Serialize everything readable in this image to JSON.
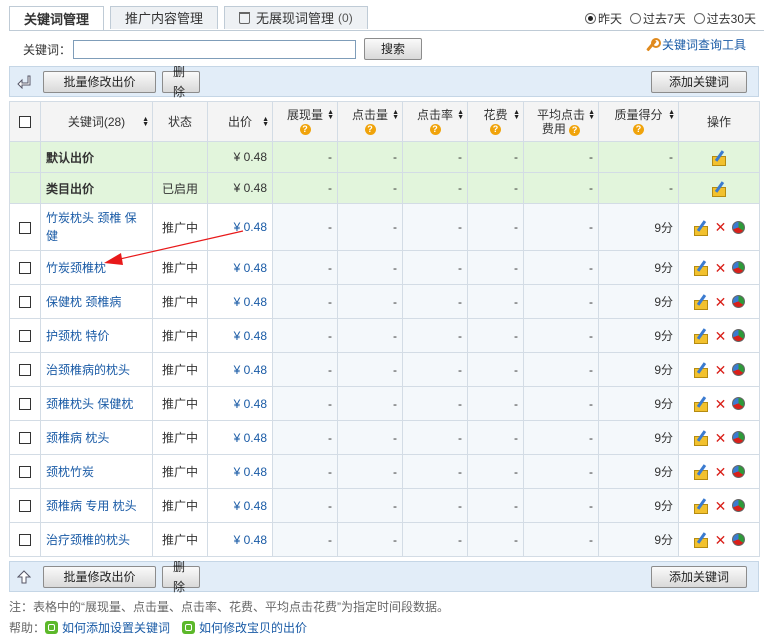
{
  "tabs": [
    {
      "label": "关键词管理",
      "active": true
    },
    {
      "label": "推广内容管理",
      "active": false
    },
    {
      "label": "无展现词管理",
      "count": "(0)",
      "active": false
    }
  ],
  "time_ranges": [
    {
      "label": "昨天",
      "selected": true
    },
    {
      "label": "过去7天",
      "selected": false
    },
    {
      "label": "过去30天",
      "selected": false
    }
  ],
  "search": {
    "label": "关键词：",
    "value": "",
    "placeholder": "",
    "button": "搜索",
    "tool_link": "关键词查询工具",
    "tool_icon": "wrench-icon"
  },
  "actions": {
    "bulk_price": "批量修改出价",
    "delete": "删除",
    "add_keyword": "添加关键词"
  },
  "table": {
    "headers": {
      "keyword": "关键词(28)",
      "status": "状态",
      "bid": "出价",
      "impressions": "展现量",
      "clicks": "点击量",
      "ctr": "点击率",
      "cost": "花费",
      "avg_cpc_line1": "平均点击",
      "avg_cpc_line2": "费用",
      "quality": "质量得分",
      "ops": "操作"
    },
    "default_rows": [
      {
        "name": "默认出价",
        "status": "",
        "bid": "¥ 0.48",
        "impressions": "-",
        "clicks": "-",
        "ctr": "-",
        "cost": "-",
        "avg_cpc": "-",
        "quality": "-"
      },
      {
        "name": "类目出价",
        "status": "已启用",
        "bid": "¥ 0.48",
        "impressions": "-",
        "clicks": "-",
        "ctr": "-",
        "cost": "-",
        "avg_cpc": "-",
        "quality": "-"
      }
    ],
    "rows": [
      {
        "keyword": "竹炭枕头  颈椎  保健",
        "status": "推广中",
        "bid": "¥ 0.48",
        "impressions": "-",
        "clicks": "-",
        "ctr": "-",
        "cost": "-",
        "avg_cpc": "-",
        "quality": "9分"
      },
      {
        "keyword": "竹炭颈椎枕",
        "status": "推广中",
        "bid": "¥ 0.48",
        "impressions": "-",
        "clicks": "-",
        "ctr": "-",
        "cost": "-",
        "avg_cpc": "-",
        "quality": "9分"
      },
      {
        "keyword": "保健枕  颈椎病",
        "status": "推广中",
        "bid": "¥ 0.48",
        "impressions": "-",
        "clicks": "-",
        "ctr": "-",
        "cost": "-",
        "avg_cpc": "-",
        "quality": "9分"
      },
      {
        "keyword": "护颈枕  特价",
        "status": "推广中",
        "bid": "¥ 0.48",
        "impressions": "-",
        "clicks": "-",
        "ctr": "-",
        "cost": "-",
        "avg_cpc": "-",
        "quality": "9分"
      },
      {
        "keyword": "治颈椎病的枕头",
        "status": "推广中",
        "bid": "¥ 0.48",
        "impressions": "-",
        "clicks": "-",
        "ctr": "-",
        "cost": "-",
        "avg_cpc": "-",
        "quality": "9分"
      },
      {
        "keyword": "颈椎枕头  保健枕",
        "status": "推广中",
        "bid": "¥ 0.48",
        "impressions": "-",
        "clicks": "-",
        "ctr": "-",
        "cost": "-",
        "avg_cpc": "-",
        "quality": "9分"
      },
      {
        "keyword": "颈椎病  枕头",
        "status": "推广中",
        "bid": "¥ 0.48",
        "impressions": "-",
        "clicks": "-",
        "ctr": "-",
        "cost": "-",
        "avg_cpc": "-",
        "quality": "9分"
      },
      {
        "keyword": "颈枕竹炭",
        "status": "推广中",
        "bid": "¥ 0.48",
        "impressions": "-",
        "clicks": "-",
        "ctr": "-",
        "cost": "-",
        "avg_cpc": "-",
        "quality": "9分"
      },
      {
        "keyword": "颈椎病  专用  枕头",
        "status": "推广中",
        "bid": "¥ 0.48",
        "impressions": "-",
        "clicks": "-",
        "ctr": "-",
        "cost": "-",
        "avg_cpc": "-",
        "quality": "9分"
      },
      {
        "keyword": "治疗颈椎的枕头",
        "status": "推广中",
        "bid": "¥ 0.48",
        "impressions": "-",
        "clicks": "-",
        "ctr": "-",
        "cost": "-",
        "avg_cpc": "-",
        "quality": "9分"
      }
    ]
  },
  "note": "注：表格中的“展现量、点击量、点击率、花费、平均点击花费”为指定时间段数据。",
  "help": {
    "label": "帮助：",
    "links": [
      "如何添加设置关键词",
      "如何修改宝贝的出价"
    ]
  },
  "colors": {
    "link": "#1a5ba6",
    "bar_bg": "#e2edf8",
    "default_row_bg": "#e2f5dc",
    "annotation_arrow": "#e8191a"
  }
}
